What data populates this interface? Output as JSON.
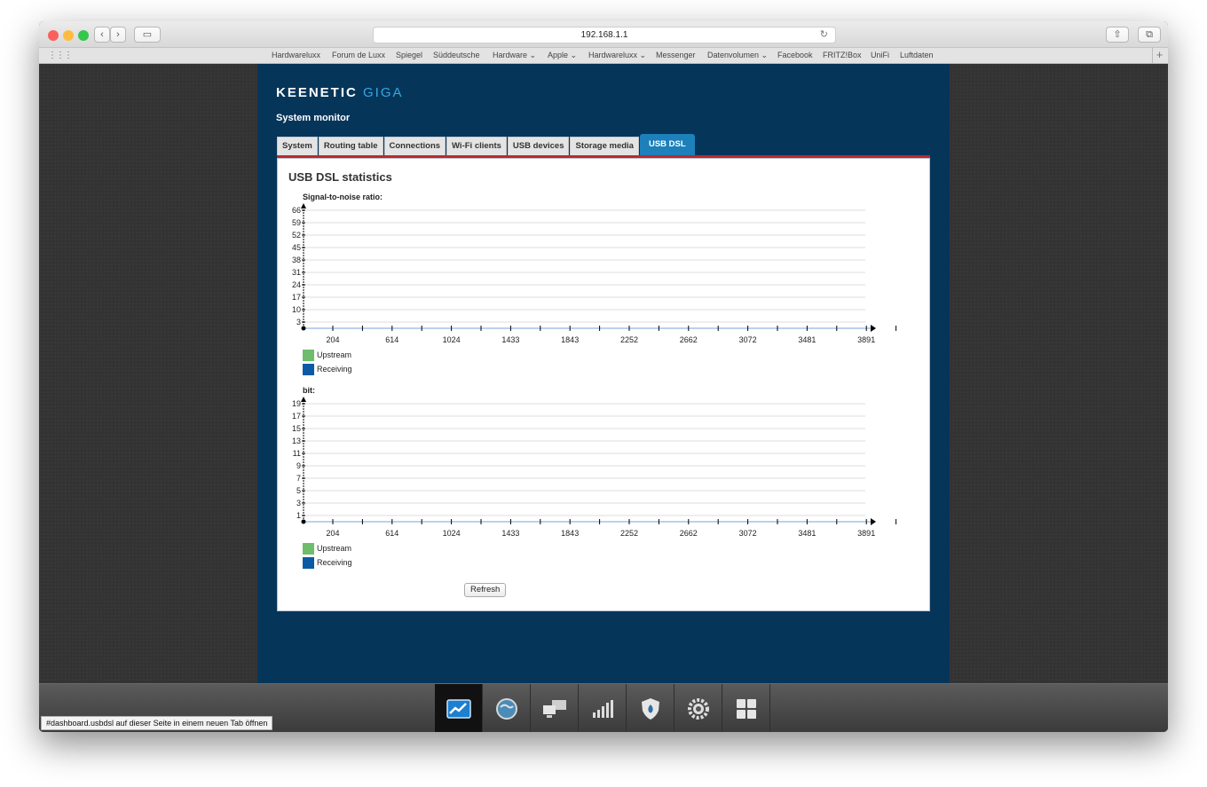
{
  "browser": {
    "url": "192.168.1.1",
    "bookmarks": [
      "Hardwareluxx",
      "Forum de Luxx",
      "Spiegel",
      "Süddeutsche",
      "Hardware ⌄",
      "Apple ⌄",
      "Hardwareluxx ⌄",
      "Messenger",
      "Datenvolumen ⌄",
      "Facebook",
      "FRITZ!Box",
      "UniFi",
      "Luftdaten"
    ],
    "status_text": "#dashboard.usbdsl auf dieser Seite in einem neuen Tab öffnen"
  },
  "router": {
    "logo_main": "KEENETIC",
    "logo_sub": "GIGA",
    "page_title": "System monitor",
    "tabs": [
      {
        "label": "System",
        "active": false
      },
      {
        "label": "Routing table",
        "active": false
      },
      {
        "label": "Connections",
        "active": false
      },
      {
        "label": "Wi-Fi clients",
        "active": false
      },
      {
        "label": "USB devices",
        "active": false
      },
      {
        "label": "Storage media",
        "active": false
      },
      {
        "label": "USB DSL",
        "active": true
      }
    ],
    "panel_title": "USB DSL statistics",
    "refresh_label": "Refresh",
    "dock_icons": [
      "monitor-chart-icon",
      "globe-icon",
      "network-computers-icon",
      "signal-bars-icon",
      "shield-icon",
      "gear-icon",
      "apps-grid-icon"
    ]
  },
  "chart_data": [
    {
      "type": "line",
      "title": "Signal-to-noise ratio:",
      "x_ticks": [
        204,
        614,
        1024,
        1433,
        1843,
        2252,
        2662,
        3072,
        3481,
        3891
      ],
      "y_ticks": [
        3,
        10,
        17,
        24,
        31,
        38,
        45,
        52,
        59,
        66
      ],
      "series": [
        {
          "name": "Upstream",
          "color": "#6dbd6d",
          "values": []
        },
        {
          "name": "Receiving",
          "color": "#0b5aa6",
          "values": []
        }
      ]
    },
    {
      "type": "line",
      "title": "bit:",
      "x_ticks": [
        204,
        614,
        1024,
        1433,
        1843,
        2252,
        2662,
        3072,
        3481,
        3891
      ],
      "y_ticks": [
        1,
        3,
        5,
        7,
        9,
        11,
        13,
        15,
        17,
        19
      ],
      "series": [
        {
          "name": "Upstream",
          "color": "#6dbd6d",
          "values": []
        },
        {
          "name": "Receiving",
          "color": "#0b5aa6",
          "values": []
        }
      ]
    }
  ]
}
